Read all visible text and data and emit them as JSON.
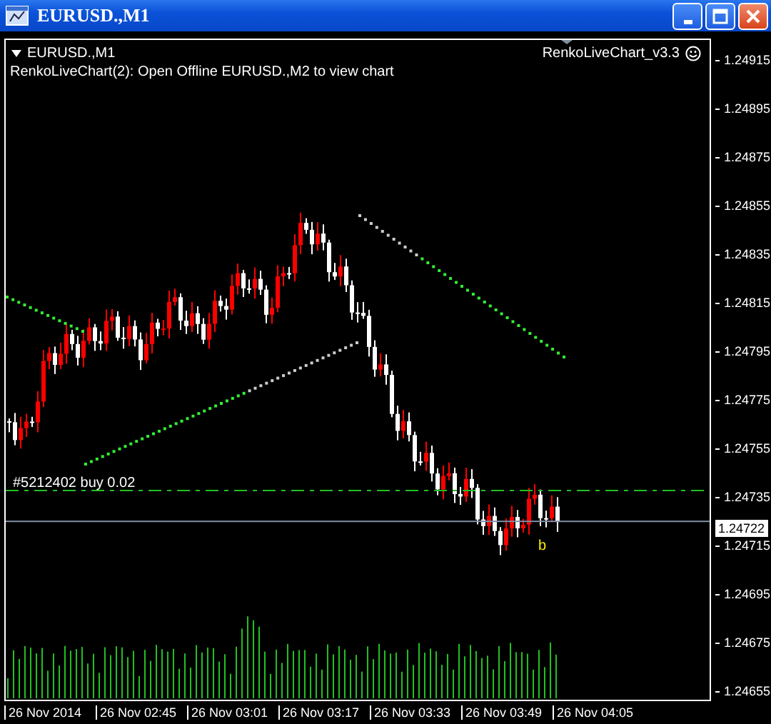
{
  "window": {
    "title": "EURUSD.,M1"
  },
  "chart": {
    "symbol": "EURUSD.,M1",
    "indicator_name": "RenkoLiveChart_v3.3",
    "message": "RenkoLiveChart(2): Open Offline EURUSD.,M2 to view chart",
    "order_label": "#5212402 buy 0.02",
    "trade_marker": "b",
    "current_price": "1.24722",
    "price_ticks": [
      "1.24915",
      "1.24895",
      "1.24875",
      "1.24855",
      "1.24835",
      "1.24815",
      "1.24795",
      "1.24775",
      "1.24755",
      "1.24735",
      "1.24715",
      "1.24695",
      "1.24675",
      "1.24655"
    ],
    "time_ticks": [
      "26 Nov 2014",
      "26 Nov 02:45",
      "26 Nov 03:01",
      "26 Nov 03:17",
      "26 Nov 03:33",
      "26 Nov 03:49",
      "26 Nov 04:05"
    ]
  }
}
